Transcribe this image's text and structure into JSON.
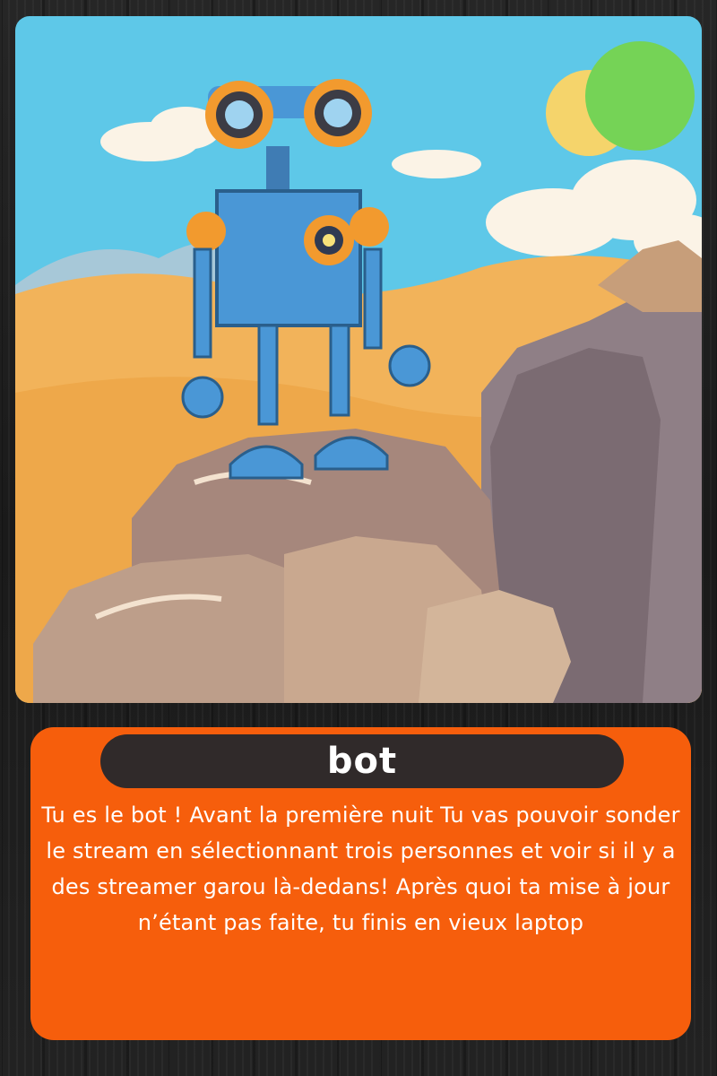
{
  "card": {
    "title": "bot",
    "description": "Tu es le bot ! Avant la première nuit Tu vas pouvoir sonder le stream en sélectionnant trois personnes et voir si il y a des streamer garou là-dedans! Après quoi ta mise à jour n’étant pas faite, tu finis en vieux laptop"
  },
  "illustration": {
    "subject": "robot-on-rock",
    "sky_color": "#5ec8e8",
    "sun_color": "#f5d46b",
    "desert_color": "#f2b35a",
    "robot_color": "#4a97d6",
    "accent_color": "#f29a2e"
  },
  "colors": {
    "panel": "#f65e0c",
    "pill": "#302a2a",
    "badge": "#75d356",
    "text": "#ffffff"
  }
}
